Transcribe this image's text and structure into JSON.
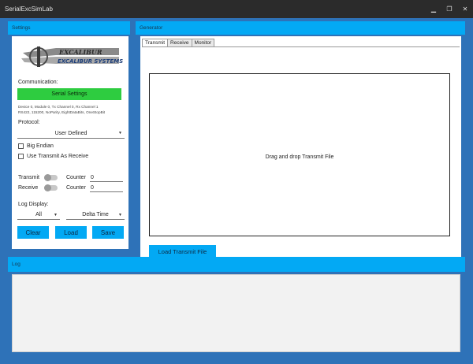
{
  "window": {
    "title": "SerialExcSimLab",
    "minimize_glyph": "▁",
    "maximize_glyph": "❐",
    "close_glyph": "✕"
  },
  "settings": {
    "header": "Settings",
    "logo": {
      "mark": "EXCALIBUR",
      "company": "EXCALIBUR SYSTEMS"
    },
    "communication_label": "Communication:",
    "serial_settings_button": "Serial Settings",
    "device_info_line1": "Device 0, Module 0, Tx Channel 0, Rx Channel 1",
    "device_info_line2": "RS422, 115200, NoParity, EightDataBits, OneStopBit",
    "protocol_label": "Protocol:",
    "protocol_value": "User Defined",
    "big_endian_label": "Big Endian",
    "big_endian_checked": false,
    "use_transmit_as_receive_label": "Use Transmit As Receive",
    "use_transmit_as_receive_checked": false,
    "transmit_label": "Transmit",
    "transmit_toggle_on": false,
    "receive_label": "Receive",
    "receive_toggle_on": false,
    "counter_label": "Counter",
    "transmit_counter": "0",
    "receive_counter": "0",
    "log_display_label": "Log Display:",
    "log_filter_value": "All",
    "log_time_value": "Delta Time",
    "clear_button": "Clear",
    "load_button": "Load",
    "save_button": "Save"
  },
  "generator": {
    "header": "Generator",
    "tabs": [
      {
        "label": "Transmit",
        "active": true
      },
      {
        "label": "Receive",
        "active": false
      },
      {
        "label": "Monitor",
        "active": false
      }
    ],
    "drop_hint": "Drag and drop Transmit File",
    "load_transmit_button": "Load Transmit File"
  },
  "log": {
    "header": "Log",
    "content": ""
  },
  "colors": {
    "background": "#2e72b8",
    "accent": "#03a9f4",
    "success": "#2ecc40",
    "titlebar": "#2b2b2b"
  },
  "icons": {
    "dropdown": "chevron-down-icon"
  }
}
